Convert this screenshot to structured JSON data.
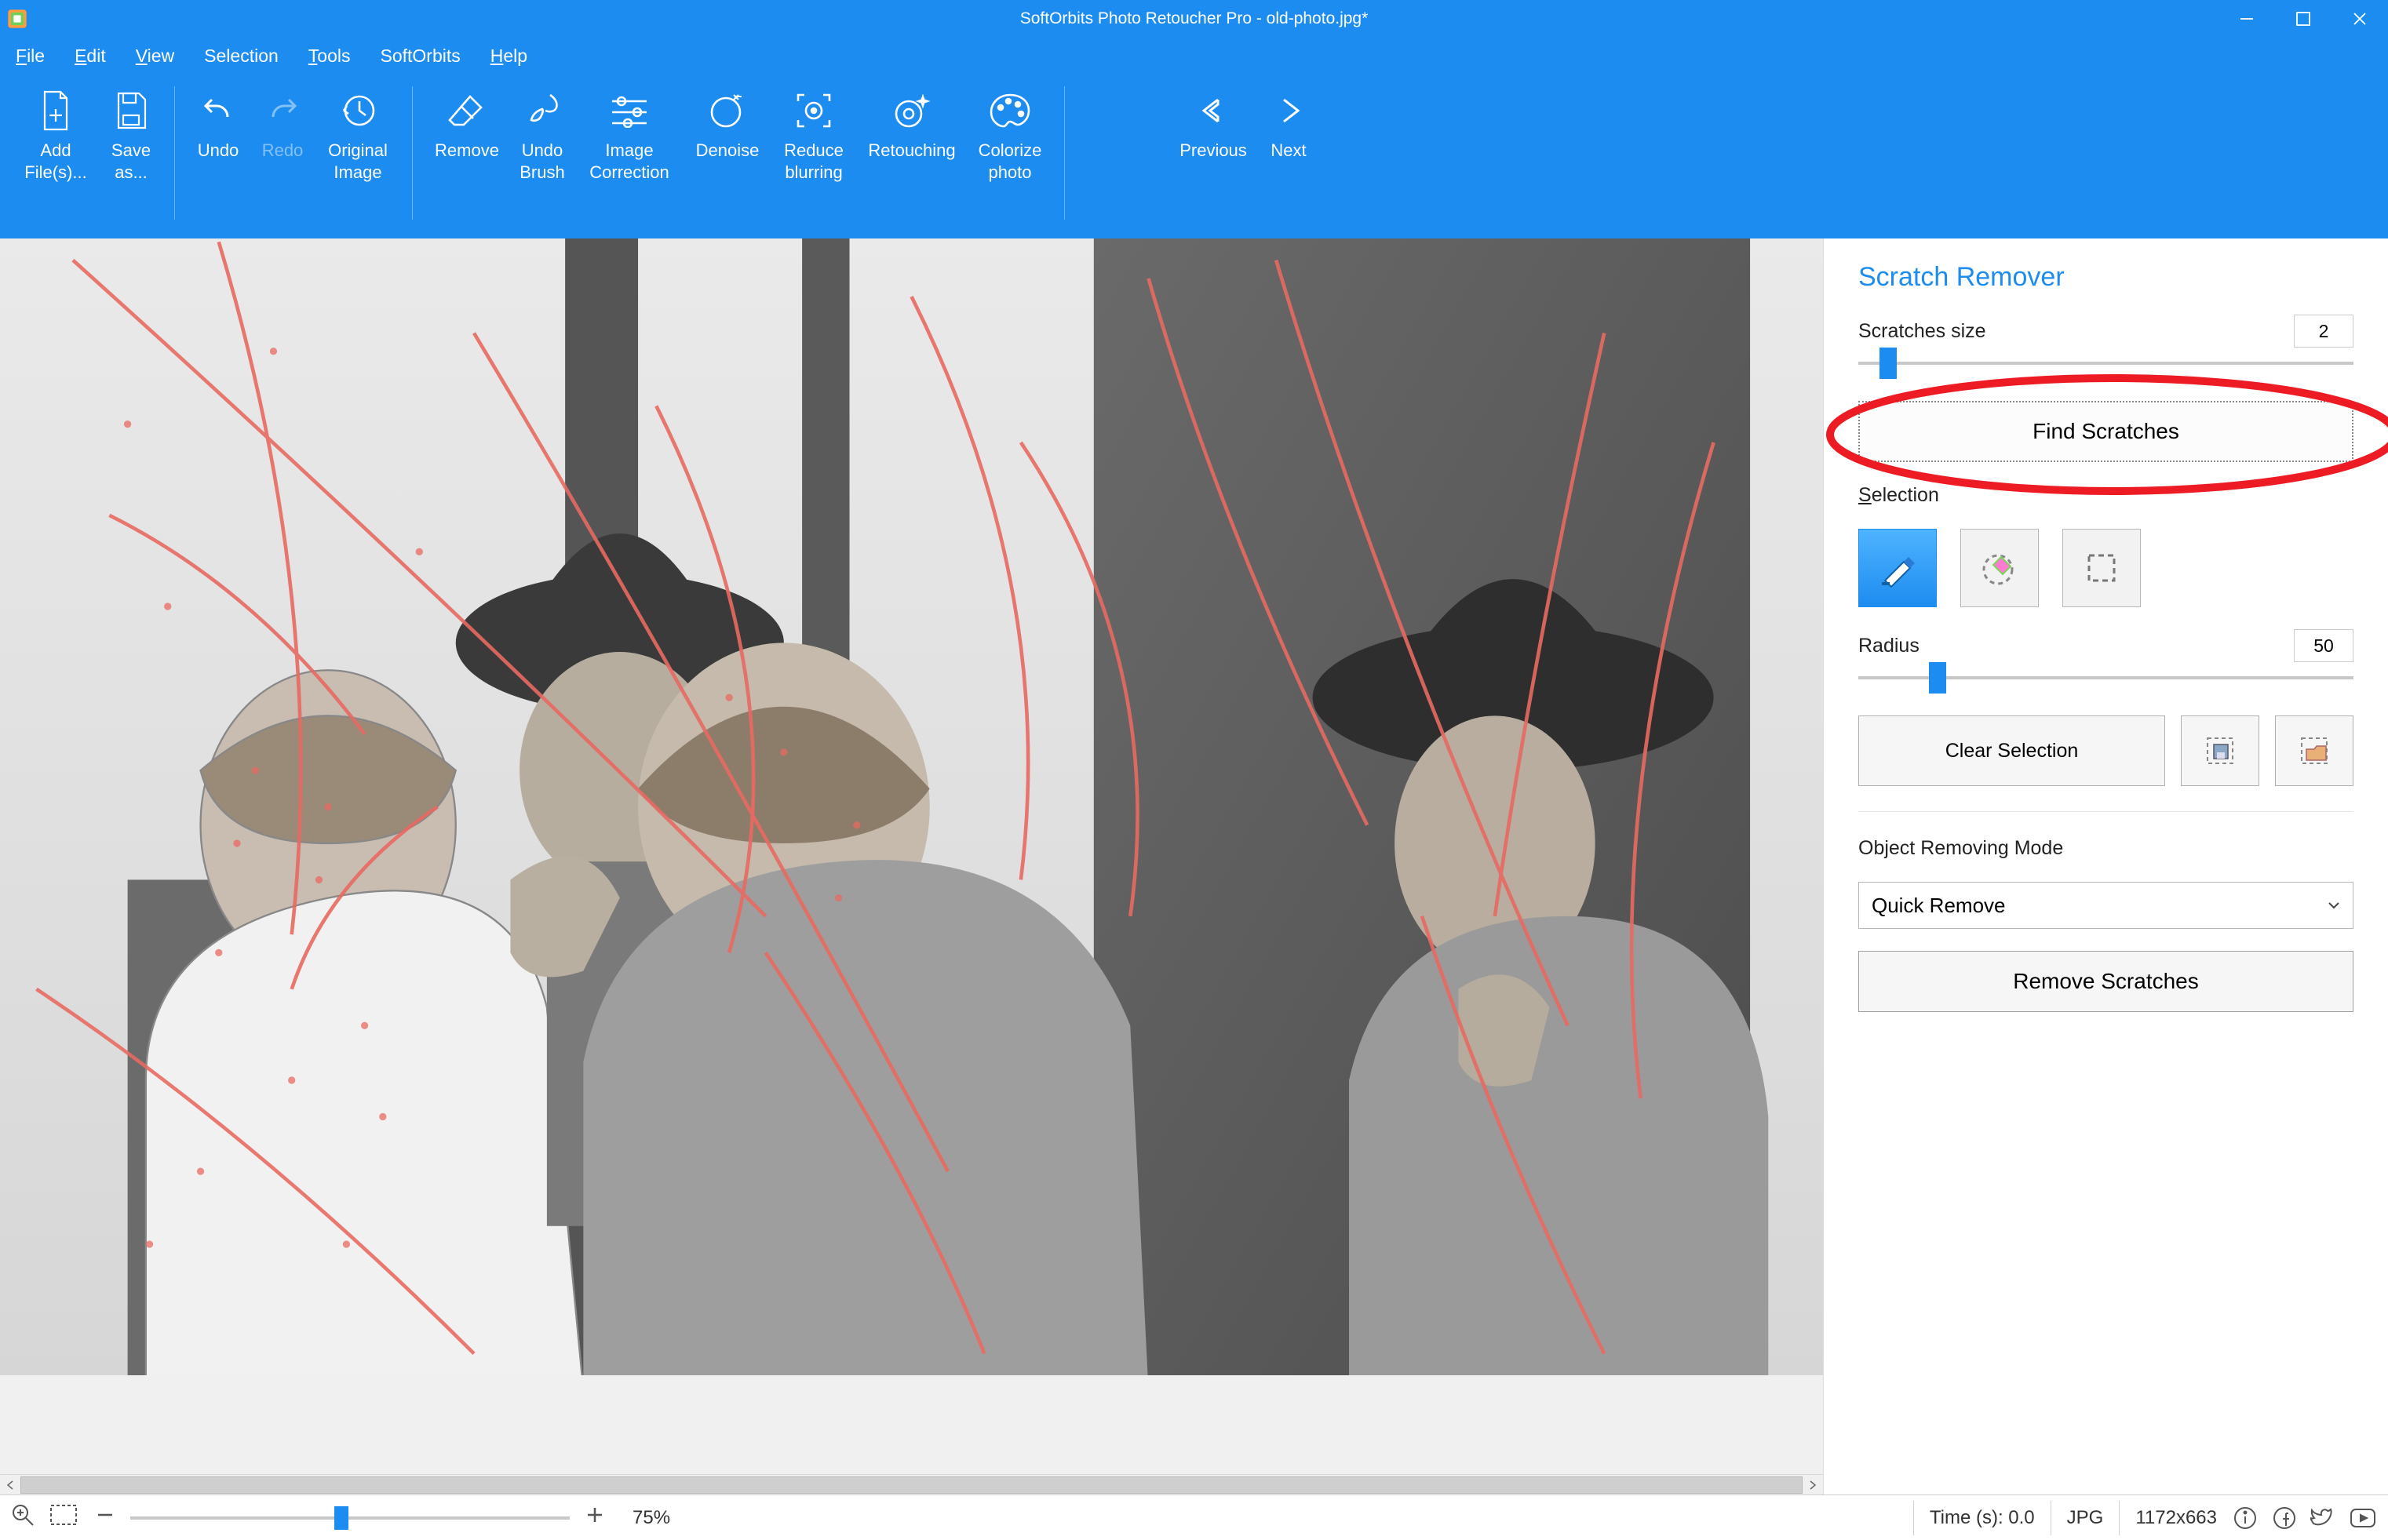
{
  "title": "SoftOrbits Photo Retoucher Pro - old-photo.jpg*",
  "menu": {
    "file": "File",
    "edit": "Edit",
    "view": "View",
    "selection": "Selection",
    "tools": "Tools",
    "softorbits": "SoftOrbits",
    "help": "Help"
  },
  "toolbar": {
    "add_files": "Add\nFile(s)...",
    "save_as": "Save\nas...",
    "undo": "Undo",
    "redo": "Redo",
    "original_image": "Original\nImage",
    "remove": "Remove",
    "undo_brush": "Undo\nBrush",
    "image_correction": "Image\nCorrection",
    "denoise": "Denoise",
    "reduce_blurring": "Reduce\nblurring",
    "retouching": "Retouching",
    "colorize": "Colorize\nphoto",
    "previous": "Previous",
    "next": "Next"
  },
  "panel": {
    "title": "Scratch Remover",
    "scratches_size_label": "Scratches size",
    "scratches_size_value": "2",
    "find_scratches": "Find Scratches",
    "selection_label": "Selection",
    "radius_label": "Radius",
    "radius_value": "50",
    "clear_selection": "Clear Selection",
    "object_removing_label": "Object Removing Mode",
    "object_removing_value": "Quick Remove",
    "remove_scratches": "Remove Scratches"
  },
  "status": {
    "zoom": "75%",
    "time": "Time (s): 0.0",
    "format": "JPG",
    "dims": "1172x663"
  },
  "colors": {
    "accent": "#1d8cf0",
    "annot": "#ed1c24"
  }
}
